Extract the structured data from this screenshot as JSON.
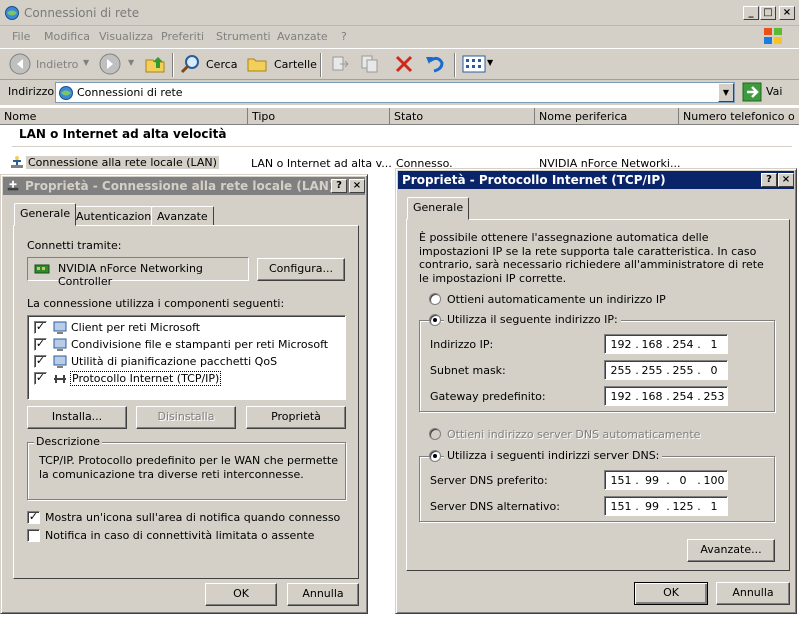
{
  "window": {
    "title": "Connessioni di rete",
    "menu": [
      "File",
      "Modifica",
      "Visualizza",
      "Preferiti",
      "Strumenti",
      "Avanzate",
      "?"
    ],
    "toolbar": {
      "back": "Indietro",
      "search": "Cerca",
      "folders": "Cartelle"
    },
    "address": {
      "label": "Indirizzo",
      "value": "Connessioni di rete",
      "go": "Vai"
    },
    "columns": [
      "Nome",
      "Tipo",
      "Stato",
      "Nome periferica",
      "Numero telefonico o indi"
    ],
    "group_title": "LAN o Internet ad alta velocità",
    "row": {
      "name": "Connessione alla rete locale (LAN)",
      "type": "LAN o Internet ad alta v...",
      "status": "Connesso.",
      "device": "NVIDIA nForce Networki..."
    }
  },
  "lan_dialog": {
    "title": "Proprietà - Connessione alla rete locale (LAN)",
    "tabs": [
      "Generale",
      "Autenticazione",
      "Avanzate"
    ],
    "connect_using_label": "Connetti tramite:",
    "adapter": "NVIDIA nForce Networking Controller",
    "configure_button": "Configura...",
    "components_label": "La connessione utilizza i componenti seguenti:",
    "components": [
      {
        "label": "Client per reti Microsoft",
        "checked": true
      },
      {
        "label": "Condivisione file e stampanti per reti Microsoft",
        "checked": true
      },
      {
        "label": "Utilità di pianificazione pacchetti QoS",
        "checked": true
      },
      {
        "label": "Protocollo Internet (TCP/IP)",
        "checked": true,
        "selected": true
      }
    ],
    "install_button": "Installa...",
    "uninstall_button": "Disinstalla",
    "properties_button": "Proprietà",
    "description_label": "Descrizione",
    "description_text": "TCP/IP. Protocollo predefinito per le WAN che permette la comunicazione tra diverse reti interconnesse.",
    "show_icon_label": "Mostra un'icona sull'area di notifica quando connesso",
    "show_icon_checked": true,
    "notify_label": "Notifica in caso di connettività limitata o assente",
    "notify_checked": false,
    "ok_button": "OK",
    "cancel_button": "Annulla"
  },
  "tcp_dialog": {
    "title": "Proprietà - Protocollo Internet (TCP/IP)",
    "tab": "Generale",
    "intro": "È possibile ottenere l'assegnazione automatica delle impostazioni IP se la rete supporta tale caratteristica. In caso contrario, sarà necessario richiedere all'amministratore di rete le impostazioni IP corrette.",
    "auto_ip_label": "Ottieni automaticamente un indirizzo IP",
    "manual_ip_label": "Utilizza il seguente indirizzo IP:",
    "ip_label": "Indirizzo IP:",
    "ip": [
      "192",
      "168",
      "254",
      "1"
    ],
    "mask_label": "Subnet mask:",
    "mask": [
      "255",
      "255",
      "255",
      "0"
    ],
    "gateway_label": "Gateway predefinito:",
    "gateway": [
      "192",
      "168",
      "254",
      "253"
    ],
    "auto_dns_label": "Ottieni indirizzo server DNS automaticamente",
    "manual_dns_label": "Utilizza i seguenti indirizzi server DNS:",
    "dns1_label": "Server DNS preferito:",
    "dns1": [
      "151",
      "99",
      "0",
      "100"
    ],
    "dns2_label": "Server DNS alternativo:",
    "dns2": [
      "151",
      "99",
      "125",
      "1"
    ],
    "advanced_button": "Avanzate...",
    "ok_button": "OK",
    "cancel_button": "Annulla"
  }
}
